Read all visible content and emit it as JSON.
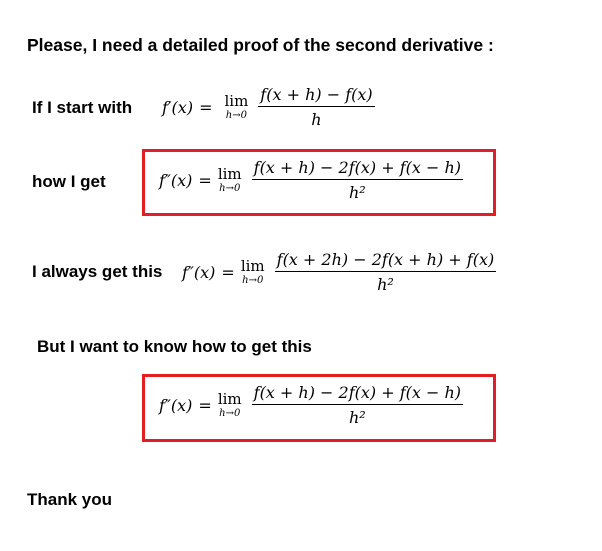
{
  "post": {
    "title": "Please, I need a detailed proof of the second derivative :",
    "line1": {
      "label": "If I start with",
      "formula": {
        "lhs": "f′(x)",
        "equals": "=",
        "lim_word": "lim",
        "lim_sub": "h→0",
        "numerator": "f(x + h) − f(x)",
        "denominator": "h"
      }
    },
    "line2": {
      "label": "how  I  get",
      "formula": {
        "lhs": "f″(x)",
        "equals": "=",
        "lim_word": "lim",
        "lim_sub": "h→0",
        "numerator": "f(x + h) − 2f(x) + f(x − h)",
        "denominator": "h²"
      }
    },
    "line3": {
      "label": "I always get this",
      "formula": {
        "lhs": "f″(x)",
        "equals": "=",
        "lim_word": "lim",
        "lim_sub": "h→0",
        "numerator": "f(x + 2h) − 2f(x + h) + f(x)",
        "denominator": "h²"
      }
    },
    "line4": {
      "label": "But I want to know how to get this",
      "formula": {
        "lhs": "f″(x)",
        "equals": "=",
        "lim_word": "lim",
        "lim_sub": "h→0",
        "numerator": "f(x + h) − 2f(x) + f(x − h)",
        "denominator": "h²"
      }
    },
    "closing": "Thank you",
    "highlight_color": "#e01e24"
  }
}
